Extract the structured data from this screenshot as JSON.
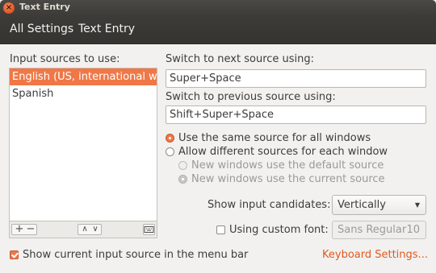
{
  "window": {
    "title": "Text Entry",
    "close_glyph": "×"
  },
  "header": {
    "all_settings": "All Settings",
    "current_page": "Text Entry"
  },
  "sources": {
    "heading": "Input sources to use:",
    "items": [
      "English (US, international with dead keys)",
      "Spanish"
    ],
    "selected_index": 0,
    "toolbar": {
      "add": "+",
      "remove": "−",
      "up": "∧",
      "down": "∨",
      "keyboard_icon": "keyboard-icon"
    }
  },
  "shortcuts": {
    "next_label": "Switch to next source using:",
    "next_value": "Super+Space",
    "prev_label": "Switch to previous source using:",
    "prev_value": "Shift+Super+Space"
  },
  "windows_mode": {
    "same_source": "Use the same source for all windows",
    "different_sources": "Allow different sources for each window",
    "new_default": "New windows use the default source",
    "new_current": "New windows use the current source",
    "selected": "same_source"
  },
  "candidates": {
    "label": "Show input candidates:",
    "value": "Vertically"
  },
  "custom_font": {
    "label": "Using custom font:",
    "font_name": "Sans Regular",
    "font_size": "10",
    "checked": false
  },
  "footer": {
    "show_current_label": "Show current input source in the menu bar",
    "show_current_checked": true,
    "keyboard_settings_link": "Keyboard Settings..."
  },
  "colors": {
    "accent": "#f07746",
    "link": "#e05a1e",
    "titlebar": "#3c3b37"
  }
}
